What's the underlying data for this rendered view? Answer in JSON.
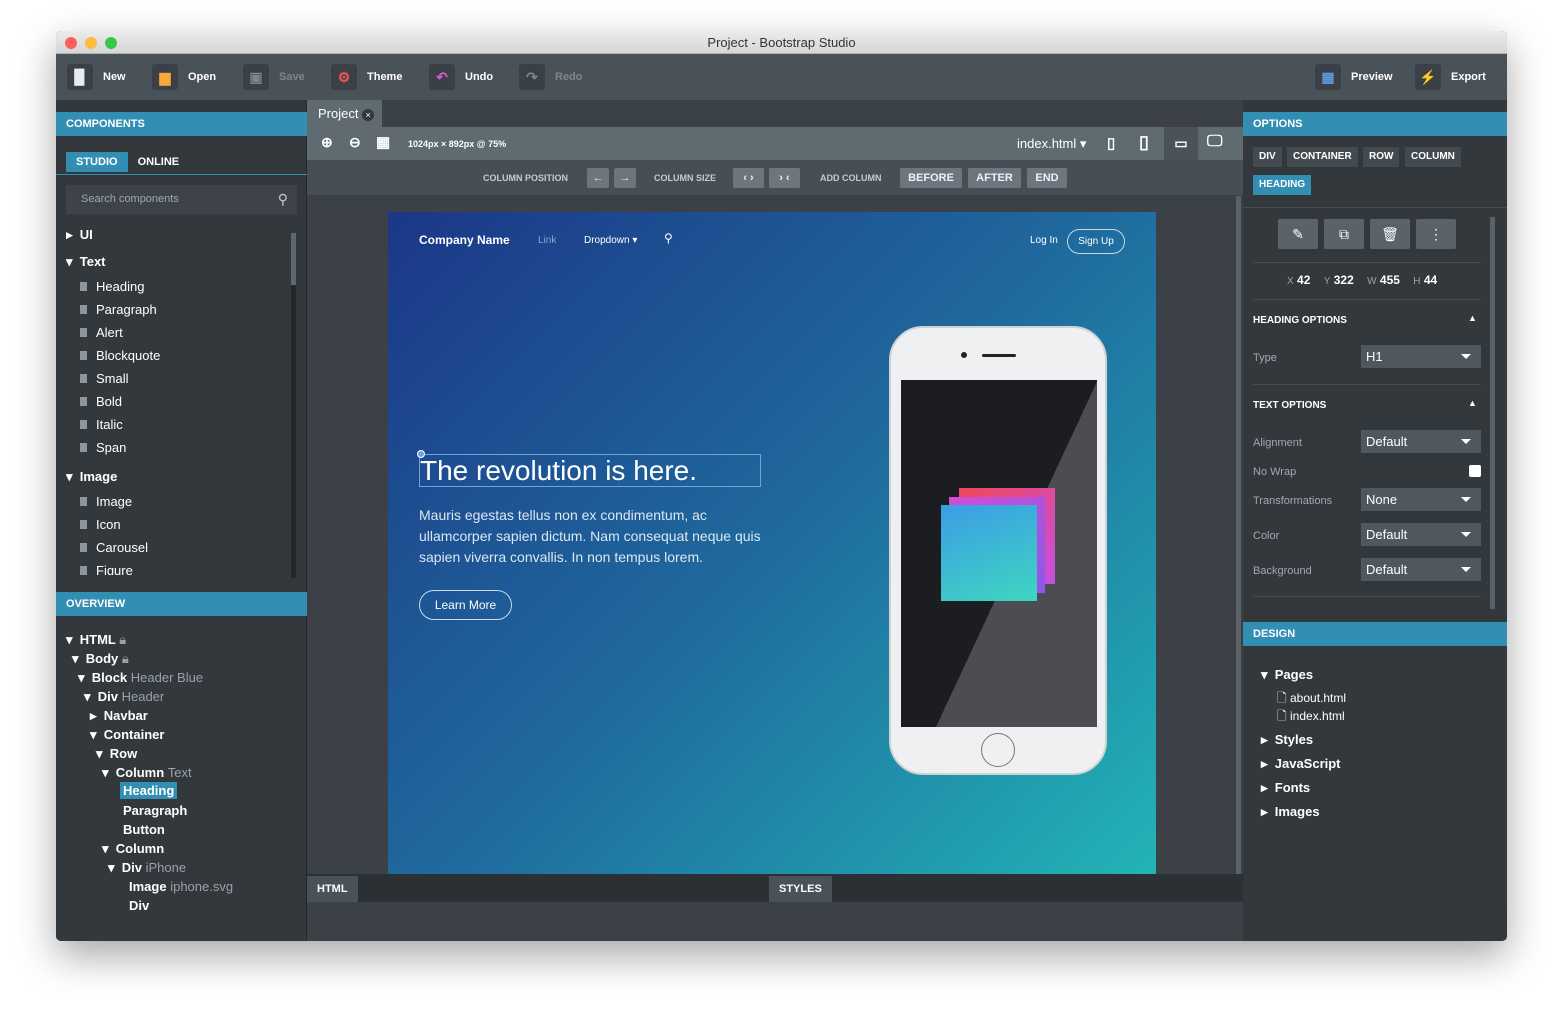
{
  "window": {
    "title": "Project - Bootstrap Studio"
  },
  "toolbar": {
    "new": "New",
    "open": "Open",
    "save": "Save",
    "theme": "Theme",
    "undo": "Undo",
    "redo": "Redo",
    "preview": "Preview",
    "export": "Export"
  },
  "components": {
    "header": "COMPONENTS",
    "tab_studio": "STUDIO",
    "tab_online": "ONLINE",
    "search_placeholder": "Search components",
    "groups": [
      {
        "label": "UI"
      },
      {
        "label": "Text",
        "items": [
          "Heading",
          "Paragraph",
          "Alert",
          "Blockquote",
          "Small",
          "Bold",
          "Italic",
          "Span"
        ]
      },
      {
        "label": "Image",
        "items": [
          "Image",
          "Icon",
          "Carousel",
          "Figure"
        ]
      }
    ]
  },
  "overview": {
    "header": "OVERVIEW",
    "nodes": [
      {
        "name": "HTML",
        "sub": ""
      },
      {
        "name": "Body",
        "sub": ""
      },
      {
        "name": "Block",
        "sub": "Header Blue"
      },
      {
        "name": "Div",
        "sub": "Header"
      },
      {
        "name": "Navbar",
        "sub": ""
      },
      {
        "name": "Container",
        "sub": ""
      },
      {
        "name": "Row",
        "sub": ""
      },
      {
        "name": "Column",
        "sub": "Text"
      },
      {
        "name": "Heading",
        "sub": ""
      },
      {
        "name": "Paragraph",
        "sub": ""
      },
      {
        "name": "Button",
        "sub": ""
      },
      {
        "name": "Column",
        "sub": ""
      },
      {
        "name": "Div",
        "sub": "iPhone"
      },
      {
        "name": "Image",
        "sub": "iphone.svg"
      },
      {
        "name": "Div",
        "sub": ""
      }
    ]
  },
  "editor": {
    "tab": "Project",
    "dimensions": "1024px × 892px @ 75%",
    "page_select": "index.html",
    "column_position": "COLUMN POSITION",
    "column_size": "COLUMN SIZE",
    "add_column": "ADD COLUMN",
    "before": "BEFORE",
    "after": "AFTER",
    "end": "END"
  },
  "preview": {
    "brand": "Company Name",
    "link": "Link",
    "dropdown": "Dropdown",
    "login": "Log In",
    "signup": "Sign Up",
    "heading": "The revolution is here.",
    "paragraph": "Mauris egestas tellus non ex condimentum, ac ullamcorper sapien dictum. Nam consequat neque quis sapien viverra convallis. In non tempus lorem.",
    "button": "Learn More"
  },
  "bottom": {
    "html": "HTML",
    "styles": "STYLES"
  },
  "options": {
    "header": "OPTIONS",
    "crumbs": [
      "DIV",
      "CONTAINER",
      "ROW",
      "COLUMN",
      "HEADING"
    ],
    "x_label": "X",
    "x": "42",
    "y_label": "Y",
    "y": "322",
    "w_label": "W",
    "w": "455",
    "h_label": "H",
    "h": "44",
    "heading_options": "HEADING OPTIONS",
    "type_label": "Type",
    "type": "H1",
    "text_options": "TEXT OPTIONS",
    "alignment_label": "Alignment",
    "alignment": "Default",
    "nowrap_label": "No Wrap",
    "nowrap": false,
    "transform_label": "Transformations",
    "transform": "None",
    "color_label": "Color",
    "color": "Default",
    "background_label": "Background",
    "background": "Default"
  },
  "design": {
    "header": "DESIGN",
    "pages_label": "Pages",
    "pages": [
      "about.html",
      "index.html"
    ],
    "styles": "Styles",
    "javascript": "JavaScript",
    "fonts": "Fonts",
    "images": "Images"
  },
  "colors": {
    "accent": "#338eb4",
    "toolbar": "#4a5259",
    "panel": "#33383d"
  }
}
